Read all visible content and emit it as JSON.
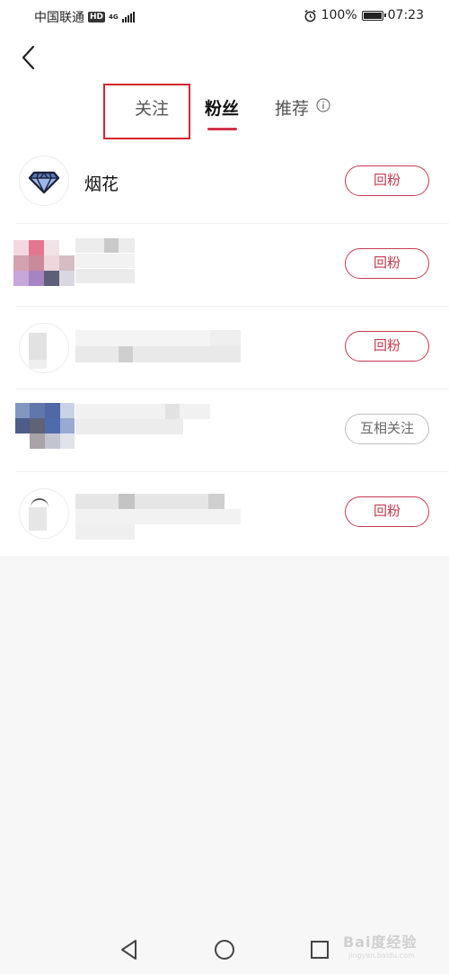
{
  "status_bar": {
    "carrier": "中国联通",
    "hd": "HD",
    "network": "4G",
    "battery": "100%",
    "battery_level": 1.0,
    "time": "07:23"
  },
  "tabs": [
    {
      "label": "关注",
      "active": false
    },
    {
      "label": "粉丝",
      "active": true
    },
    {
      "label": "推荐",
      "active": false
    }
  ],
  "fans": [
    {
      "name": "烟花",
      "avatar": "diamond-icon",
      "action": "回粉"
    },
    {
      "name": "",
      "avatar": "pixelated",
      "action": "回粉"
    },
    {
      "name": "",
      "avatar": "pixelated",
      "action": "回粉"
    },
    {
      "name": "",
      "avatar": "pixelated",
      "action": "互相关注"
    },
    {
      "name": "",
      "avatar": "pixelated",
      "action": "回粉"
    }
  ],
  "watermark": {
    "text": "Bai度经验",
    "sub": "jingyan.baidu.com"
  },
  "colors": {
    "accent": "#c43a4e",
    "highlight_box": "#d6262f",
    "background": "#f7f7f7"
  }
}
